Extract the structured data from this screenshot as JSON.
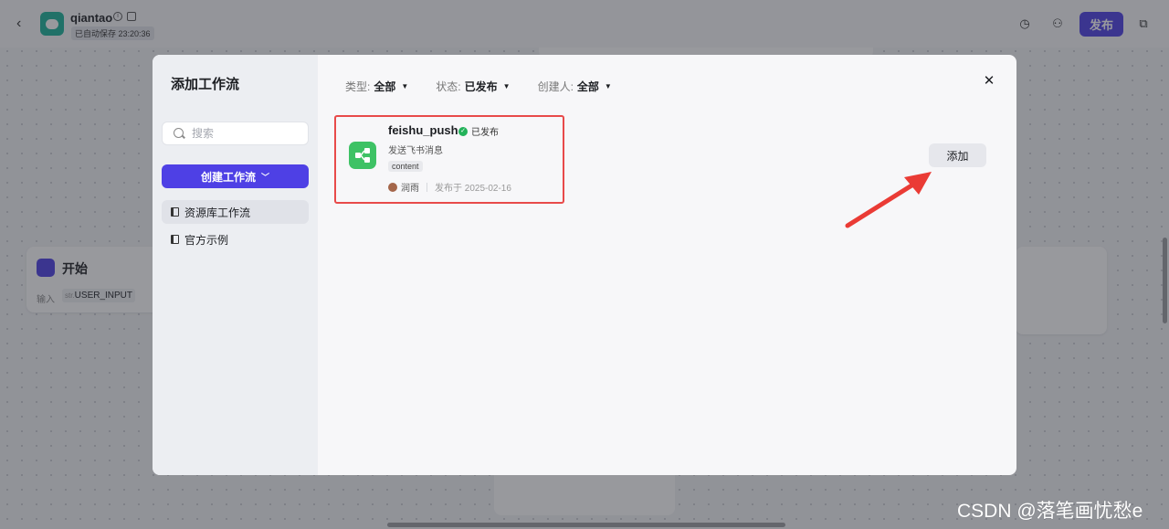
{
  "header": {
    "app_name": "qiantao",
    "autosave": "已自动保存 23:20:36",
    "publish_label": "发布"
  },
  "canvas": {
    "start_node": {
      "title": "开始",
      "input_label": "输入",
      "variable_type": "str.",
      "variable_name": "USER_INPUT"
    }
  },
  "modal": {
    "title": "添加工作流",
    "search": {
      "placeholder": "搜索"
    },
    "create_button": "创建工作流",
    "sidebar_items": [
      {
        "label": "资源库工作流",
        "active": true
      },
      {
        "label": "官方示例",
        "active": false
      }
    ],
    "filters": [
      {
        "label": "类型:",
        "value": "全部"
      },
      {
        "label": "状态:",
        "value": "已发布"
      },
      {
        "label": "创建人:",
        "value": "全部"
      }
    ],
    "workflow": {
      "name": "feishu_push",
      "status": "已发布",
      "description": "发送飞书消息",
      "tag": "content",
      "author": "润雨",
      "published": "发布于 2025-02-16"
    },
    "add_button": "添加"
  },
  "watermark": "CSDN @落笔画忧愁e",
  "colors": {
    "accent": "#4e40e5",
    "success": "#23b25a",
    "highlight": "#e84a4a"
  }
}
